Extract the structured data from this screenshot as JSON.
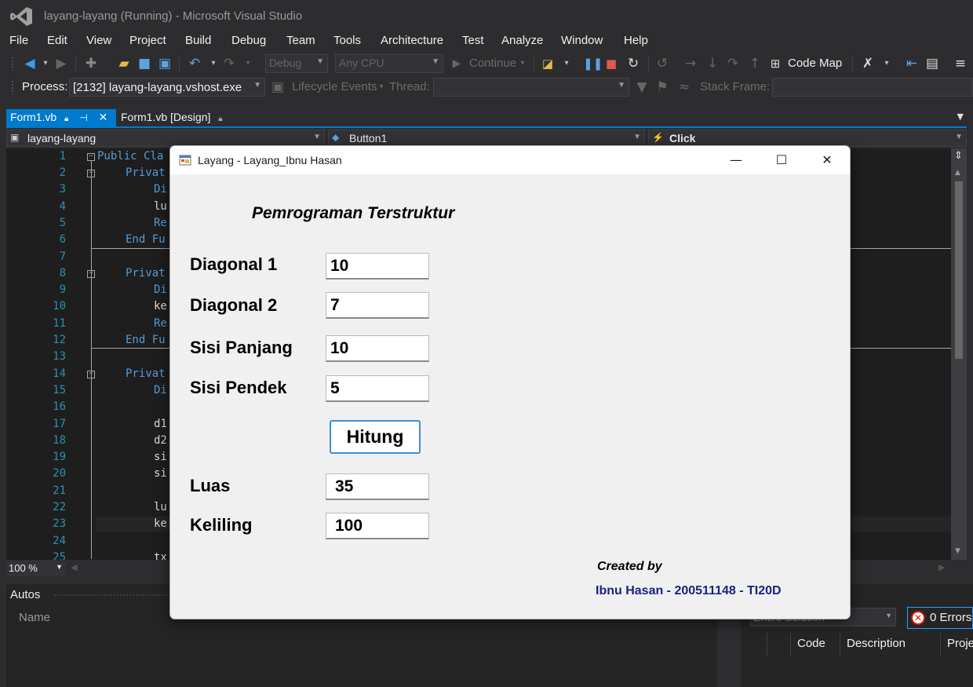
{
  "vs": {
    "title": "layang-layang (Running) - Microsoft Visual Studio",
    "menu": [
      "File",
      "Edit",
      "View",
      "Project",
      "Build",
      "Debug",
      "Team",
      "Tools",
      "Architecture",
      "Test",
      "Analyze",
      "Window",
      "Help"
    ],
    "toolbar": {
      "config": "Debug",
      "platform": "Any CPU",
      "continue_label": "Continue",
      "code_map_label": "Code Map",
      "process_label": "Process:",
      "process_value": "[2132] layang-layang.vshost.exe",
      "lifecycle_label": "Lifecycle Events",
      "thread_label": "Thread:",
      "stack_frame_label": "Stack Frame:"
    },
    "tabs": [
      {
        "label": "Form1.vb",
        "active": true
      },
      {
        "label": "Form1.vb [Design]",
        "active": false
      }
    ],
    "nav": {
      "project": "layang-layang",
      "object": "Button1",
      "event": "Click"
    },
    "editor": {
      "line_numbers": [
        "1",
        "2",
        "3",
        "4",
        "5",
        "6",
        "7",
        "8",
        "9",
        "10",
        "11",
        "12",
        "13",
        "14",
        "15",
        "16",
        "17",
        "18",
        "19",
        "20",
        "21",
        "22",
        "23",
        "24",
        "25"
      ],
      "code": [
        "Public Cla",
        "Privat",
        "Di",
        "lu",
        "Re",
        "End Fu",
        "",
        "Privat",
        "Di",
        "ke",
        "Re",
        "End Fu",
        "",
        "Privat",
        "Di",
        "",
        "d1",
        "d2",
        "si",
        "si",
        "",
        "lu",
        "ke",
        "",
        "tx"
      ],
      "zoom": "100 %"
    },
    "autos": {
      "title": "Autos",
      "col_name": "Name"
    },
    "error_list": {
      "scope": "Entire Solution",
      "errors": "0 Errors",
      "columns": [
        "Code",
        "Description",
        "Proje"
      ]
    }
  },
  "app": {
    "window_title": "Layang - Layang_Ibnu Hasan",
    "heading": "Pemrograman Terstruktur",
    "fields": [
      {
        "label": "Diagonal 1",
        "value": "10"
      },
      {
        "label": "Diagonal 2",
        "value": "7"
      },
      {
        "label": "Sisi Panjang",
        "value": "10"
      },
      {
        "label": "Sisi Pendek",
        "value": "5"
      }
    ],
    "button_label": "Hitung",
    "results": [
      {
        "label": "Luas",
        "value": "35"
      },
      {
        "label": "Keliling",
        "value": "100"
      }
    ],
    "credit_line1": "Created by",
    "credit_line2": "Ibnu Hasan - 200511148 - TI20D"
  },
  "colors": {
    "accent": "#007acc",
    "vs_background": "#2d2d30",
    "editor_background": "#1e1e1e",
    "keyword": "#569cd6",
    "line_number": "#2b91af",
    "credit_text": "#1a237e"
  }
}
